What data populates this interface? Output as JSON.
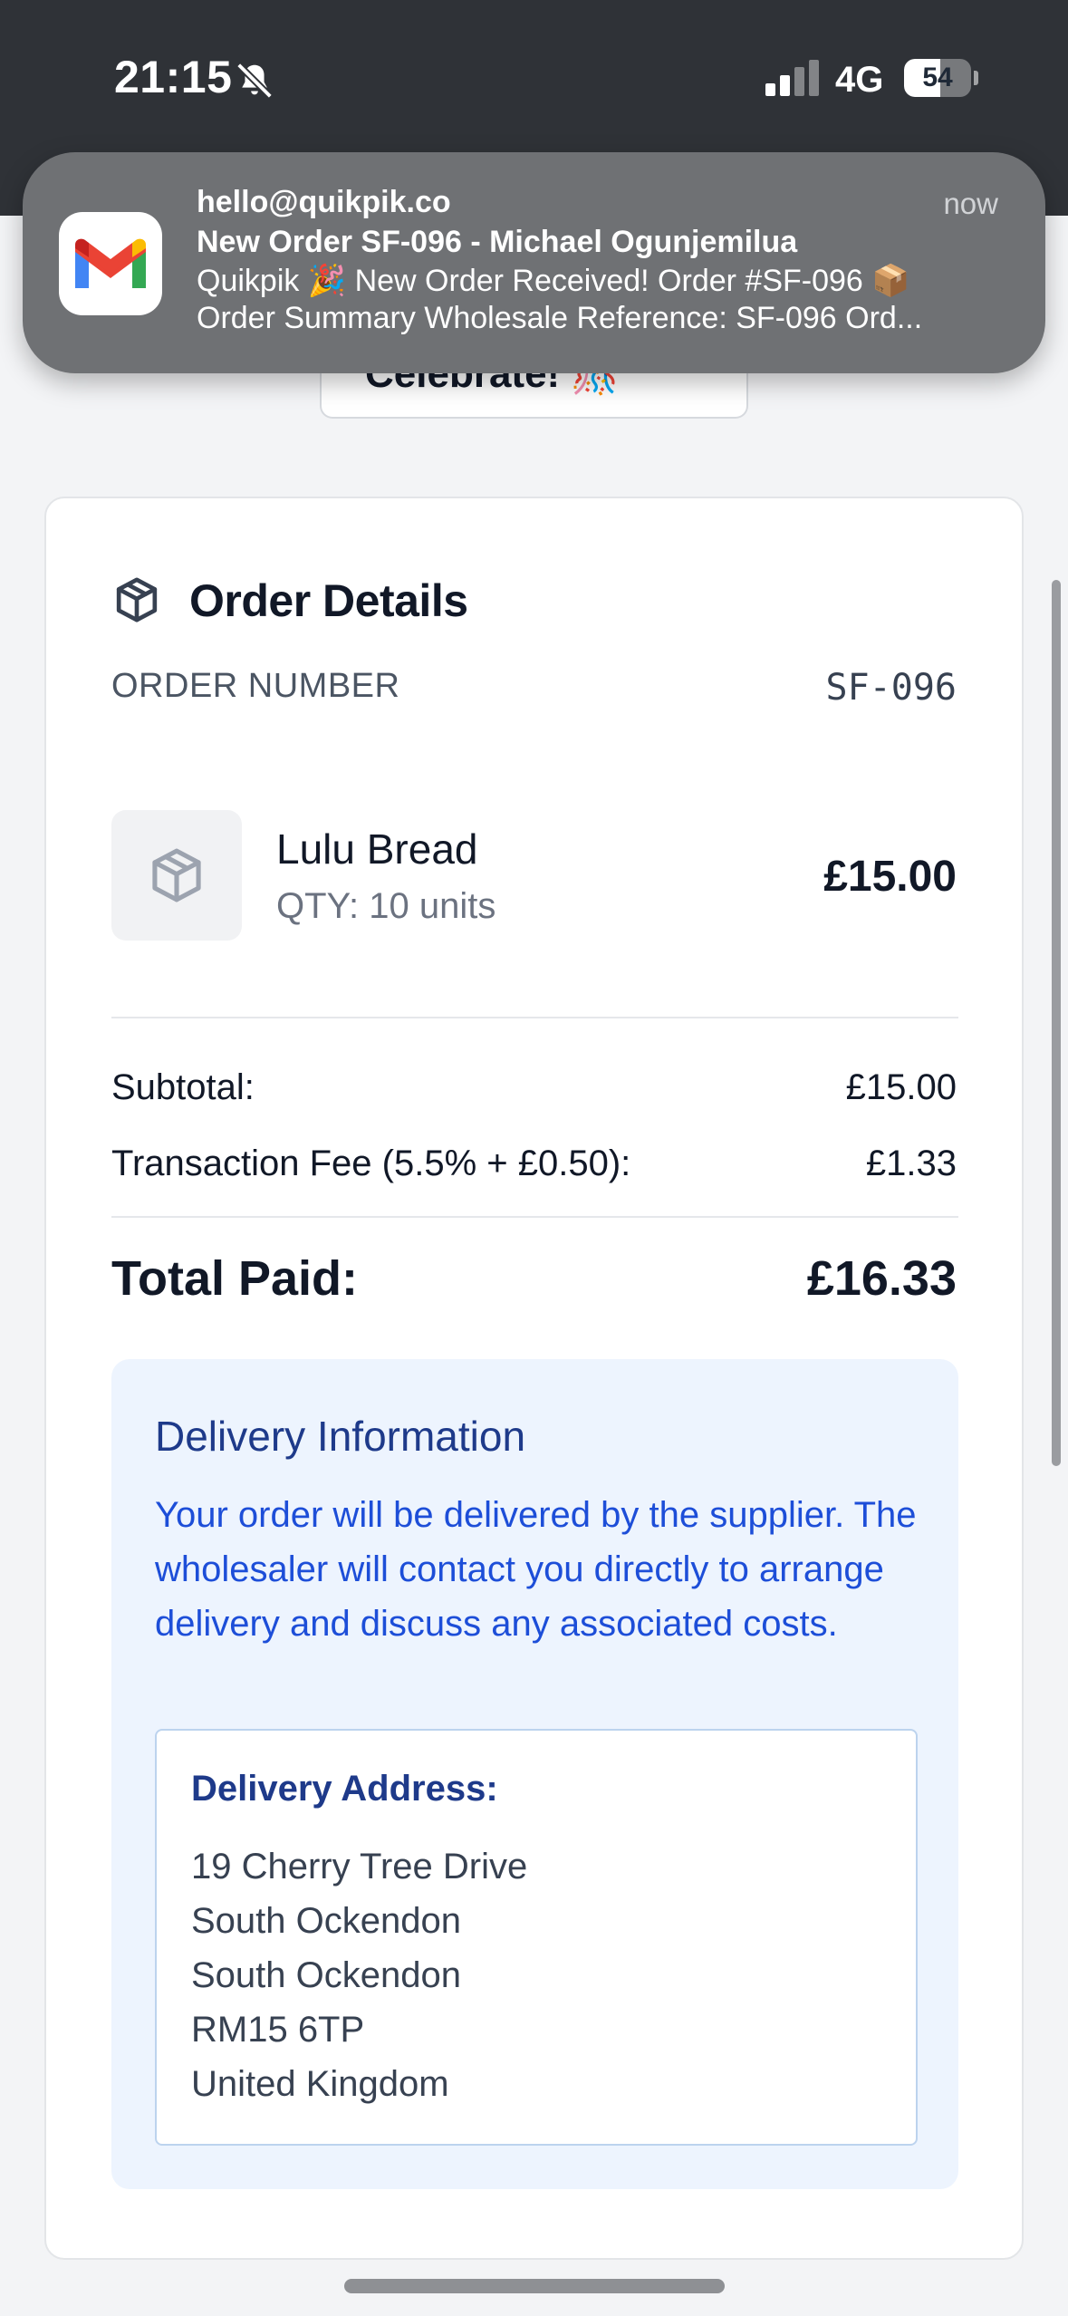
{
  "status_bar": {
    "time": "21:15",
    "network": "4G",
    "battery": "54",
    "battery_level": 0.54
  },
  "notification": {
    "app_icon": "gmail-icon",
    "sender": "hello@quikpik.co",
    "time": "now",
    "subject": "New Order SF-096 - Michael Ogunjemilua",
    "line1": "Quikpik 🎉 New Order Received! Order #SF-096 📦",
    "line2": "Order Summary Wholesale Reference: SF-096 Ord..."
  },
  "celebrate_button": {
    "label": "Celebrate! 🎊"
  },
  "order_details": {
    "title": "Order Details",
    "order_number_label": "ORDER NUMBER",
    "order_number": "SF-096",
    "item": {
      "name": "Lulu Bread",
      "qty": "QTY: 10 units",
      "price": "£15.00"
    },
    "subtotal_label": "Subtotal:",
    "subtotal": "£15.00",
    "fee_label": "Transaction Fee (5.5% + £0.50):",
    "fee": "£1.33",
    "total_label": "Total Paid:",
    "total": "£16.33"
  },
  "delivery": {
    "title": "Delivery Information",
    "text": "Your order will be delivered by the supplier. The wholesaler will contact you directly to arrange delivery and discuss any associated costs.",
    "address_title": "Delivery Address:",
    "address_lines": [
      "19 Cherry Tree Drive",
      "South Ockendon",
      "South Ockendon",
      "RM15 6TP",
      "United Kingdom"
    ]
  },
  "colors": {
    "header_bg": "#2f3237",
    "notification_bg": "#6f7174",
    "delivery_bg": "#edf4fe",
    "delivery_title": "#1e3a8a",
    "delivery_text": "#1d4ed8"
  }
}
